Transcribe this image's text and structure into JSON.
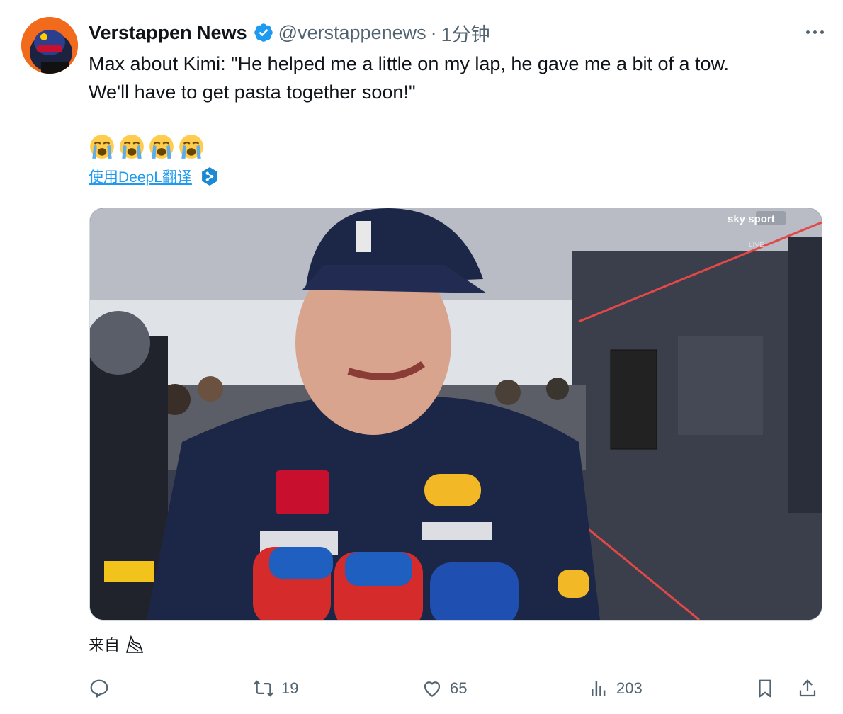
{
  "author": {
    "display_name": "Verstappen News",
    "handle": "@verstappenews",
    "separator": "·",
    "time": "1分钟",
    "verified": true,
    "avatar_icon": "helmet-avatar"
  },
  "tweet": {
    "text": "Max about Kimi: \"He helped me a little on my lap, he gave me a bit of a tow.\nWe'll have to get pasta together soon!\"",
    "emojis": [
      "loudly-crying-face",
      "loudly-crying-face",
      "loudly-crying-face",
      "loudly-crying-face"
    ],
    "translate_label": "使用DeepL翻译"
  },
  "media": {
    "broadcaster_logo": "sky sport",
    "live_label": "LIVE",
    "description_icon": "video-frame"
  },
  "source": {
    "label": "来自",
    "icon": "ghost-bird-icon"
  },
  "actions": {
    "reply_count": "",
    "retweet_count": "19",
    "like_count": "65",
    "view_count": "203"
  },
  "colors": {
    "accent": "#1d9bf0",
    "muted": "#536471",
    "text": "#0f1419"
  }
}
